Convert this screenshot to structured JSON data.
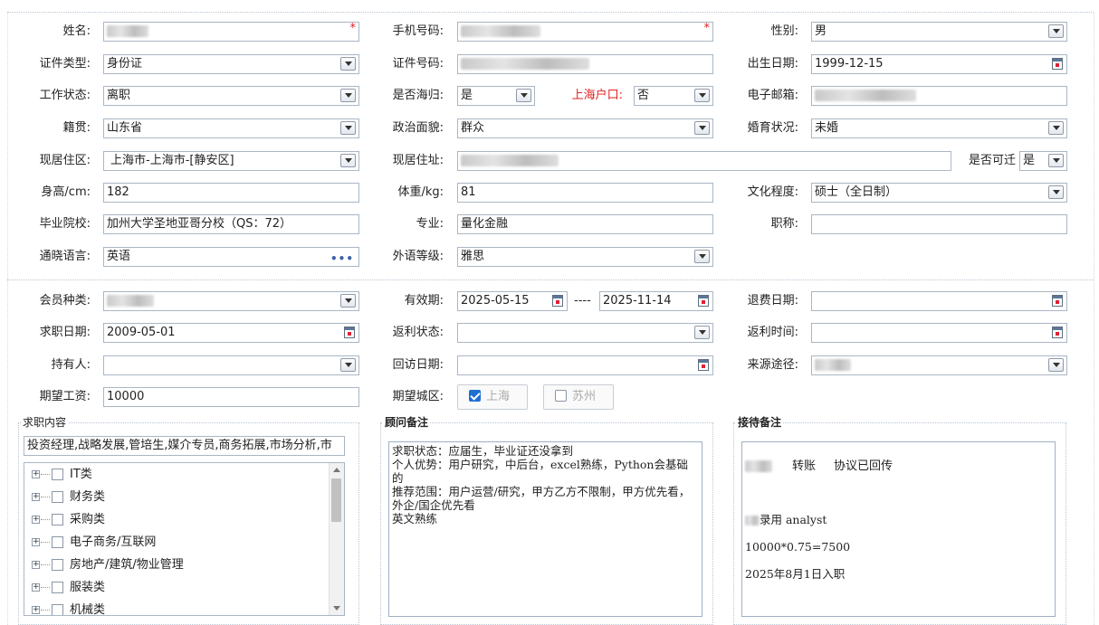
{
  "personal": {
    "name": {
      "label": "姓名:"
    },
    "phone": {
      "label": "手机号码:"
    },
    "gender": {
      "label": "性别:",
      "value": "男"
    },
    "id_type": {
      "label": "证件类型:",
      "value": "身份证"
    },
    "id_number": {
      "label": "证件号码:"
    },
    "birth_date": {
      "label": "出生日期:",
      "value": "1999-12-15"
    },
    "work_status": {
      "label": "工作状态:",
      "value": "离职"
    },
    "returnee": {
      "label": "是否海归:",
      "value": "是"
    },
    "shanghai_hukou": {
      "label": "上海户口:",
      "value": "否"
    },
    "email": {
      "label": "电子邮箱:"
    },
    "native_place": {
      "label": "籍贯:",
      "value": "山东省"
    },
    "political": {
      "label": "政治面貌:",
      "value": "群众"
    },
    "marital": {
      "label": "婚育状况:",
      "value": "未婚"
    },
    "residence_area": {
      "label": "现居住区:",
      "value": "上海市-上海市-[静安区]"
    },
    "residence_address": {
      "label": "现居住址:"
    },
    "relocate": {
      "label": "是否可迁",
      "value": "是"
    },
    "height": {
      "label": "身高/cm:",
      "value": "182"
    },
    "weight": {
      "label": "体重/kg:",
      "value": "81"
    },
    "education": {
      "label": "文化程度:",
      "value": "硕士（全日制）"
    },
    "school": {
      "label": "毕业院校:",
      "value": "加州大学圣地亚哥分校（QS：72）"
    },
    "major": {
      "label": "专业:",
      "value": "量化金融"
    },
    "title": {
      "label": "职称:",
      "value": ""
    },
    "language": {
      "label": "通晓语言:",
      "value": "英语"
    },
    "language_level": {
      "label": "外语等级:",
      "value": "雅思"
    },
    "required_mark": "*",
    "ellipsis": "•••"
  },
  "membership": {
    "member_type": {
      "label": "会员种类:"
    },
    "validity": {
      "label": "有效期:",
      "start": "2025-05-15",
      "separator": "----",
      "end": "2025-11-14"
    },
    "refund_date": {
      "label": "退费日期:",
      "value": ""
    },
    "job_seek_date": {
      "label": "求职日期:",
      "value": "2009-05-01"
    },
    "rebate_status": {
      "label": "返利状态:",
      "value": ""
    },
    "rebate_time": {
      "label": "返利时间:",
      "value": ""
    },
    "holder": {
      "label": "持有人:",
      "value": ""
    },
    "visit_date": {
      "label": "回访日期:",
      "value": ""
    },
    "source": {
      "label": "来源途径:"
    },
    "expected_salary": {
      "label": "期望工资:",
      "value": "10000"
    },
    "expected_city": {
      "label": "期望城区:",
      "options": [
        {
          "label": "上海",
          "checked": true
        },
        {
          "label": "苏州",
          "checked": false
        }
      ]
    }
  },
  "job_content": {
    "title": "求职内容",
    "selected": "投资经理,战略发展,管培生,媒介专员,商务拓展,市场分析,市",
    "tree": [
      "IT类",
      "财务类",
      "采购类",
      "电子商务/互联网",
      "房地产/建筑/物业管理",
      "服装类",
      "机械类"
    ]
  },
  "consultant_notes": {
    "title": "顾问备注",
    "text": "求职状态：应届生，毕业证还没拿到\n个人优势：用户研究，中后台，excel熟练，Python会基础的\n推荐范围：用户运营/研究，甲方乙方不限制，甲方优先看，外企/国企优先看\n英文熟练"
  },
  "reception_notes": {
    "title": "接待备注",
    "line1_a": "转账",
    "line1_b": "协议已回传",
    "line2": "录用 analyst",
    "line3": "10000*0.75=7500",
    "line4": "2025年8月1日入职"
  }
}
